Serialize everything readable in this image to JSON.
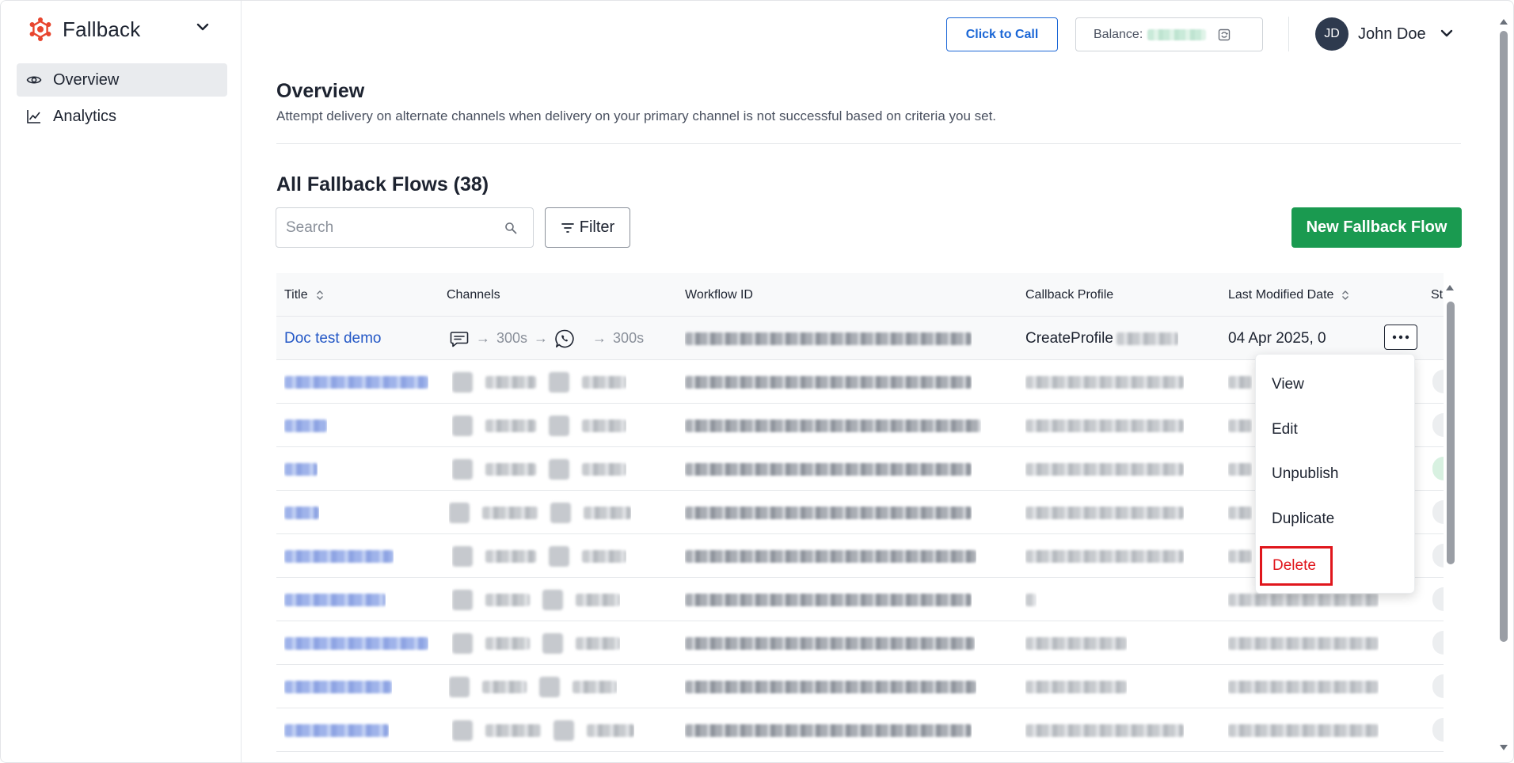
{
  "sidebar": {
    "brand": "Fallback",
    "items": [
      {
        "label": "Overview",
        "icon": "eye-icon"
      },
      {
        "label": "Analytics",
        "icon": "line-chart-icon"
      }
    ]
  },
  "header": {
    "call_button": "Click to Call",
    "balance_label": "Balance:",
    "user_initials": "JD",
    "user_name": "John Doe"
  },
  "page": {
    "title": "Overview",
    "description": "Attempt delivery on alternate channels when delivery on your primary channel is not successful based on criteria you set.",
    "flows_title": "All Fallback Flows (38)",
    "search_placeholder": "Search",
    "filter_label": "Filter",
    "new_button": "New Fallback Flow"
  },
  "table": {
    "columns": [
      "Title",
      "Channels",
      "Workflow ID",
      "Callback Profile",
      "Last Modified Date",
      "St"
    ],
    "first_row": {
      "title": "Doc test demo",
      "arrow1": "→",
      "delay1": "300s",
      "arrow2": "→",
      "arrow3": "→",
      "delay2": "300s",
      "callback": "CreateProfile",
      "date": "04 Apr 2025, 0"
    }
  },
  "menu": {
    "items": [
      "View",
      "Edit",
      "Unpublish",
      "Duplicate"
    ],
    "delete": "Delete"
  },
  "colors": {
    "primary_blue": "#1a66d6",
    "link_blue": "#2458c6",
    "green": "#1a9a50",
    "danger": "#e0161c",
    "avatar": "#2e3a4e"
  }
}
